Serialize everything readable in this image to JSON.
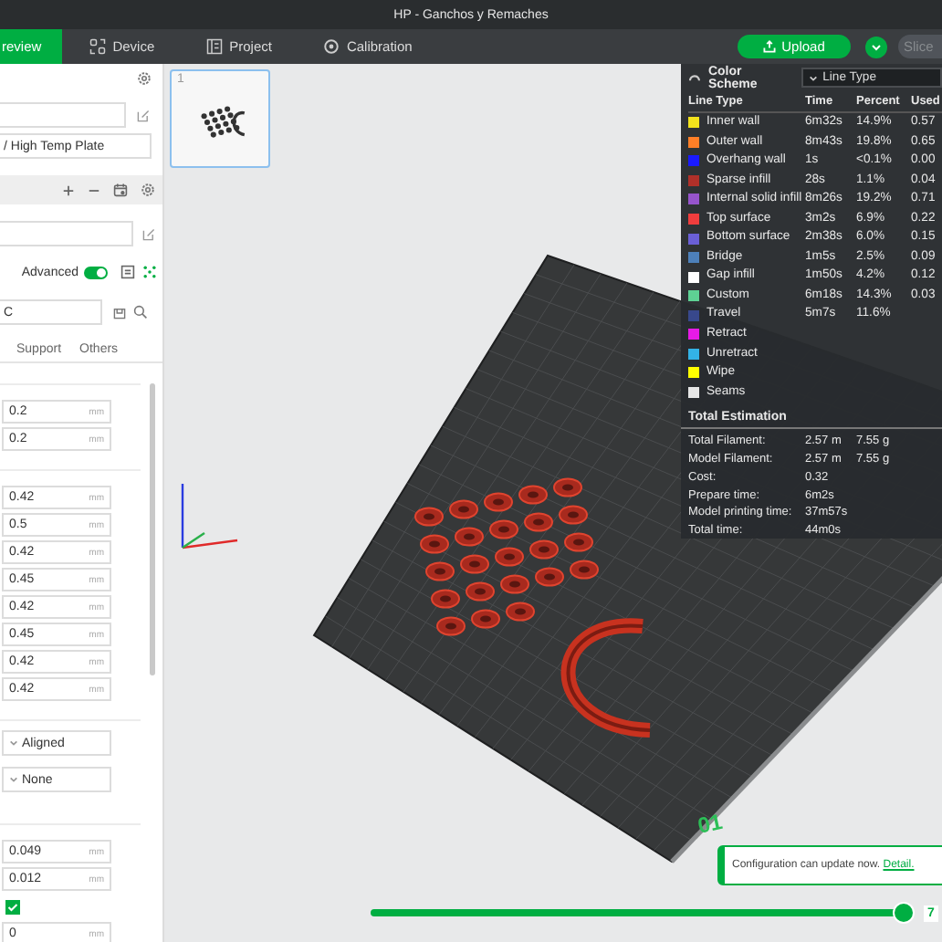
{
  "window": {
    "title": "HP - Ganchos y Remaches"
  },
  "nav": {
    "tabs": [
      {
        "label": "review",
        "selected": true
      },
      {
        "label": "Device",
        "selected": false
      },
      {
        "label": "Project",
        "selected": false
      },
      {
        "label": "Calibration",
        "selected": false
      }
    ],
    "upload": "Upload",
    "slice": {
      "label": "Slice",
      "disabled": true
    }
  },
  "settings": {
    "plate_type": "/ High Temp Plate",
    "advanced": {
      "label": "Advanced",
      "on": true
    },
    "search": {
      "value": "C"
    },
    "tabs": [
      {
        "label": "Support",
        "selected": false
      },
      {
        "label": "Others",
        "selected": false
      }
    ],
    "groups": [
      {
        "items": [
          {
            "kind": "number",
            "value": "0.2",
            "unit": "mm"
          },
          {
            "kind": "number",
            "value": "0.2",
            "unit": "mm"
          }
        ]
      },
      {
        "items": [
          {
            "kind": "number",
            "value": "0.42",
            "unit": "mm"
          },
          {
            "kind": "number",
            "value": "0.5",
            "unit": "mm"
          },
          {
            "kind": "number",
            "value": "0.42",
            "unit": "mm"
          },
          {
            "kind": "number",
            "value": "0.45",
            "unit": "mm"
          },
          {
            "kind": "number",
            "value": "0.42",
            "unit": "mm"
          },
          {
            "kind": "number",
            "value": "0.45",
            "unit": "mm"
          },
          {
            "kind": "number",
            "value": "0.42",
            "unit": "mm"
          },
          {
            "kind": "number",
            "value": "0.42",
            "unit": "mm"
          }
        ]
      },
      {
        "items": [
          {
            "kind": "dropdown",
            "value": "Aligned"
          },
          {
            "kind": "dropdown",
            "value": "None"
          }
        ]
      },
      {
        "items": [
          {
            "kind": "number",
            "value": "0.049",
            "unit": "mm"
          },
          {
            "kind": "number",
            "value": "0.012",
            "unit": "mm"
          },
          {
            "kind": "checkbox",
            "checked": true
          },
          {
            "kind": "number",
            "value": "0",
            "unit": "mm"
          }
        ]
      }
    ]
  },
  "viewport": {
    "plate_label": "01",
    "thumbnails": [
      {
        "label": "1",
        "selected": true
      }
    ]
  },
  "legend": {
    "title": "Color Scheme",
    "scheme": "Line Type",
    "columns": [
      "Line Type",
      "Time",
      "Percent",
      "Used"
    ],
    "rows": [
      {
        "name": "Inner wall",
        "color": "#f2e21c",
        "time": "6m32s",
        "percent": "14.9%",
        "used": "0.57"
      },
      {
        "name": "Outer wall",
        "color": "#ff7f27",
        "time": "8m43s",
        "percent": "19.8%",
        "used": "0.65"
      },
      {
        "name": "Overhang wall",
        "color": "#1a1aff",
        "time": "1s",
        "percent": "<0.1%",
        "used": "0.00"
      },
      {
        "name": "Sparse infill",
        "color": "#b03029",
        "time": "28s",
        "percent": "1.1%",
        "used": "0.04"
      },
      {
        "name": "Internal solid infill",
        "color": "#9654cc",
        "time": "8m26s",
        "percent": "19.2%",
        "used": "0.71"
      },
      {
        "name": "Top surface",
        "color": "#f03d3d",
        "time": "3m2s",
        "percent": "6.9%",
        "used": "0.22"
      },
      {
        "name": "Bottom surface",
        "color": "#6a5fd6",
        "time": "2m38s",
        "percent": "6.0%",
        "used": "0.15"
      },
      {
        "name": "Bridge",
        "color": "#4d80ba",
        "time": "1m5s",
        "percent": "2.5%",
        "used": "0.09"
      },
      {
        "name": "Gap infill",
        "color": "#ffffff",
        "time": "1m50s",
        "percent": "4.2%",
        "used": "0.12"
      },
      {
        "name": "Custom",
        "color": "#5ed194",
        "time": "6m18s",
        "percent": "14.3%",
        "used": "0.03"
      },
      {
        "name": "Travel",
        "color": "#38488c",
        "time": "5m7s",
        "percent": "11.6%"
      },
      {
        "name": "Retract",
        "color": "#e61ae6"
      },
      {
        "name": "Unretract",
        "color": "#33b2e6"
      },
      {
        "name": "Wipe",
        "color": "#ffff00"
      },
      {
        "name": "Seams",
        "color": "#e6e6e6"
      }
    ],
    "totals_title": "Total Estimation",
    "totals": [
      {
        "label": "Total Filament:",
        "value": "2.57 m",
        "weight": "7.55 g"
      },
      {
        "label": "Model Filament:",
        "value": "2.57 m",
        "weight": "7.55 g"
      },
      {
        "label": "Cost:",
        "value": "0.32"
      },
      {
        "label": "Prepare time:",
        "value": "6m2s"
      },
      {
        "label": "Model printing time:",
        "value": "37m57s"
      },
      {
        "label": "Total time:",
        "value": "44m0s"
      }
    ]
  },
  "notice": {
    "message": "Configuration can update now.",
    "link": "Detail."
  },
  "layer_slider": {
    "level": 0.98,
    "value": "7"
  }
}
